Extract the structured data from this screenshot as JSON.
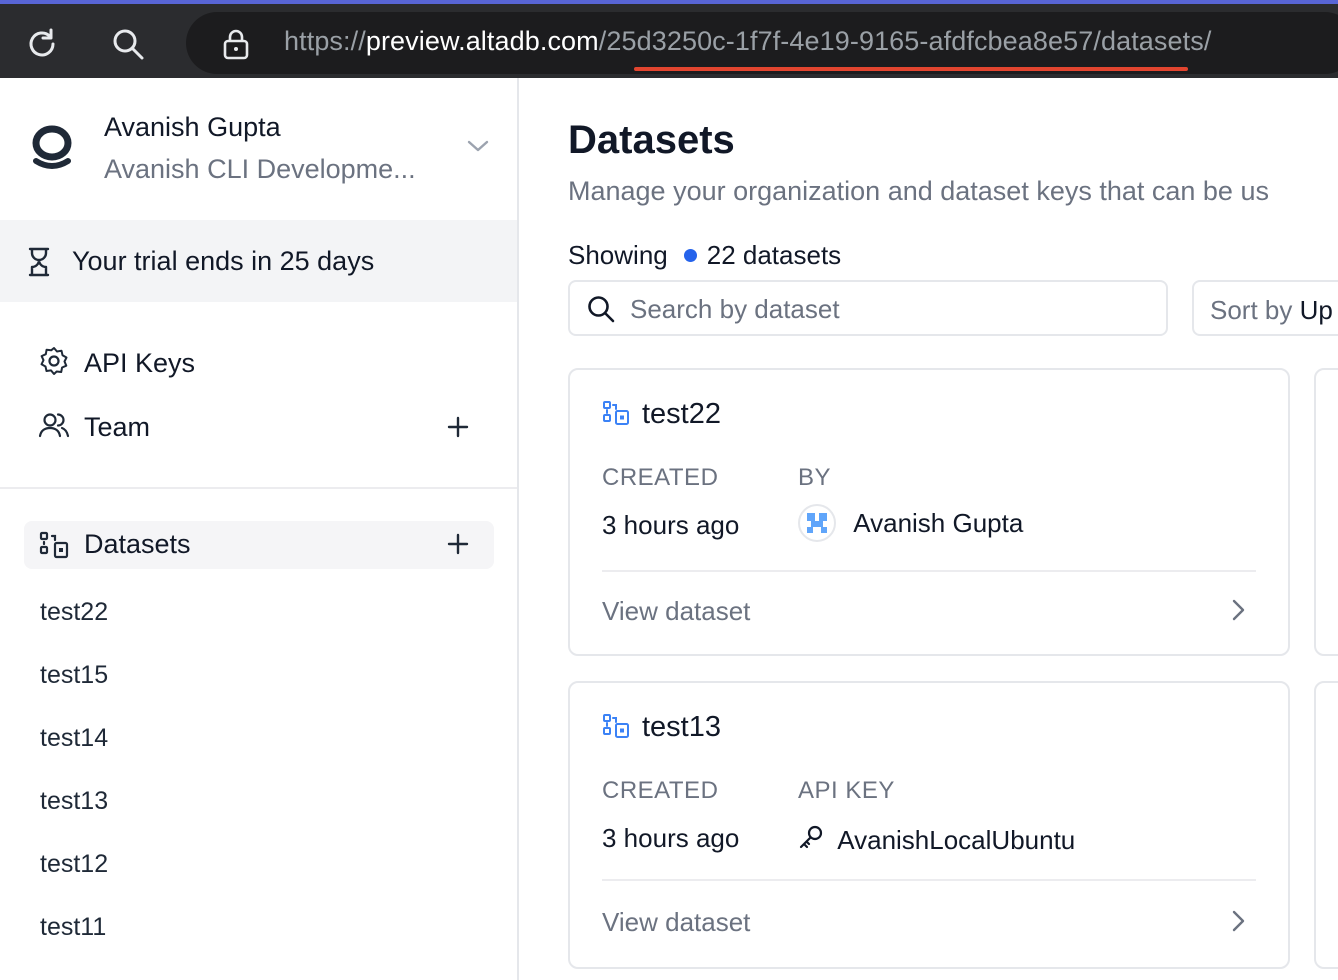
{
  "browser": {
    "url_scheme": "https://",
    "url_host": "preview.altadb.com",
    "url_path": "/25d3250c-1f7f-4e19-9165-afdfcbea8e57/datasets/"
  },
  "sidebar": {
    "org_name": "Avanish Gupta",
    "org_subtitle": "Avanish CLI Developme...",
    "trial_text": "Your trial ends in 25 days",
    "nav": {
      "api_keys": "API Keys",
      "team": "Team"
    },
    "datasets_label": "Datasets",
    "dataset_links": [
      "test22",
      "test15",
      "test14",
      "test13",
      "test12",
      "test11"
    ]
  },
  "main": {
    "title": "Datasets",
    "subtitle": "Manage your organization and dataset keys that can be us",
    "showing_label": "Showing",
    "showing_count": "22 datasets",
    "search_placeholder": "Search by dataset",
    "sort_prefix": "Sort by",
    "sort_value": "Up",
    "cards": [
      {
        "name": "test22",
        "created_label": "CREATED",
        "created_value": "3 hours ago",
        "meta_label": "BY",
        "meta_value": "Avanish Gupta",
        "view_label": "View dataset"
      },
      {
        "name": "test13",
        "created_label": "CREATED",
        "created_value": "3 hours ago",
        "meta_label": "API KEY",
        "meta_value": "AvanishLocalUbuntu",
        "view_label": "View dataset"
      }
    ]
  },
  "colors": {
    "accent": "#2563eb",
    "url_underline": "#e2452f",
    "browser_bg": "#2b2c2f"
  }
}
